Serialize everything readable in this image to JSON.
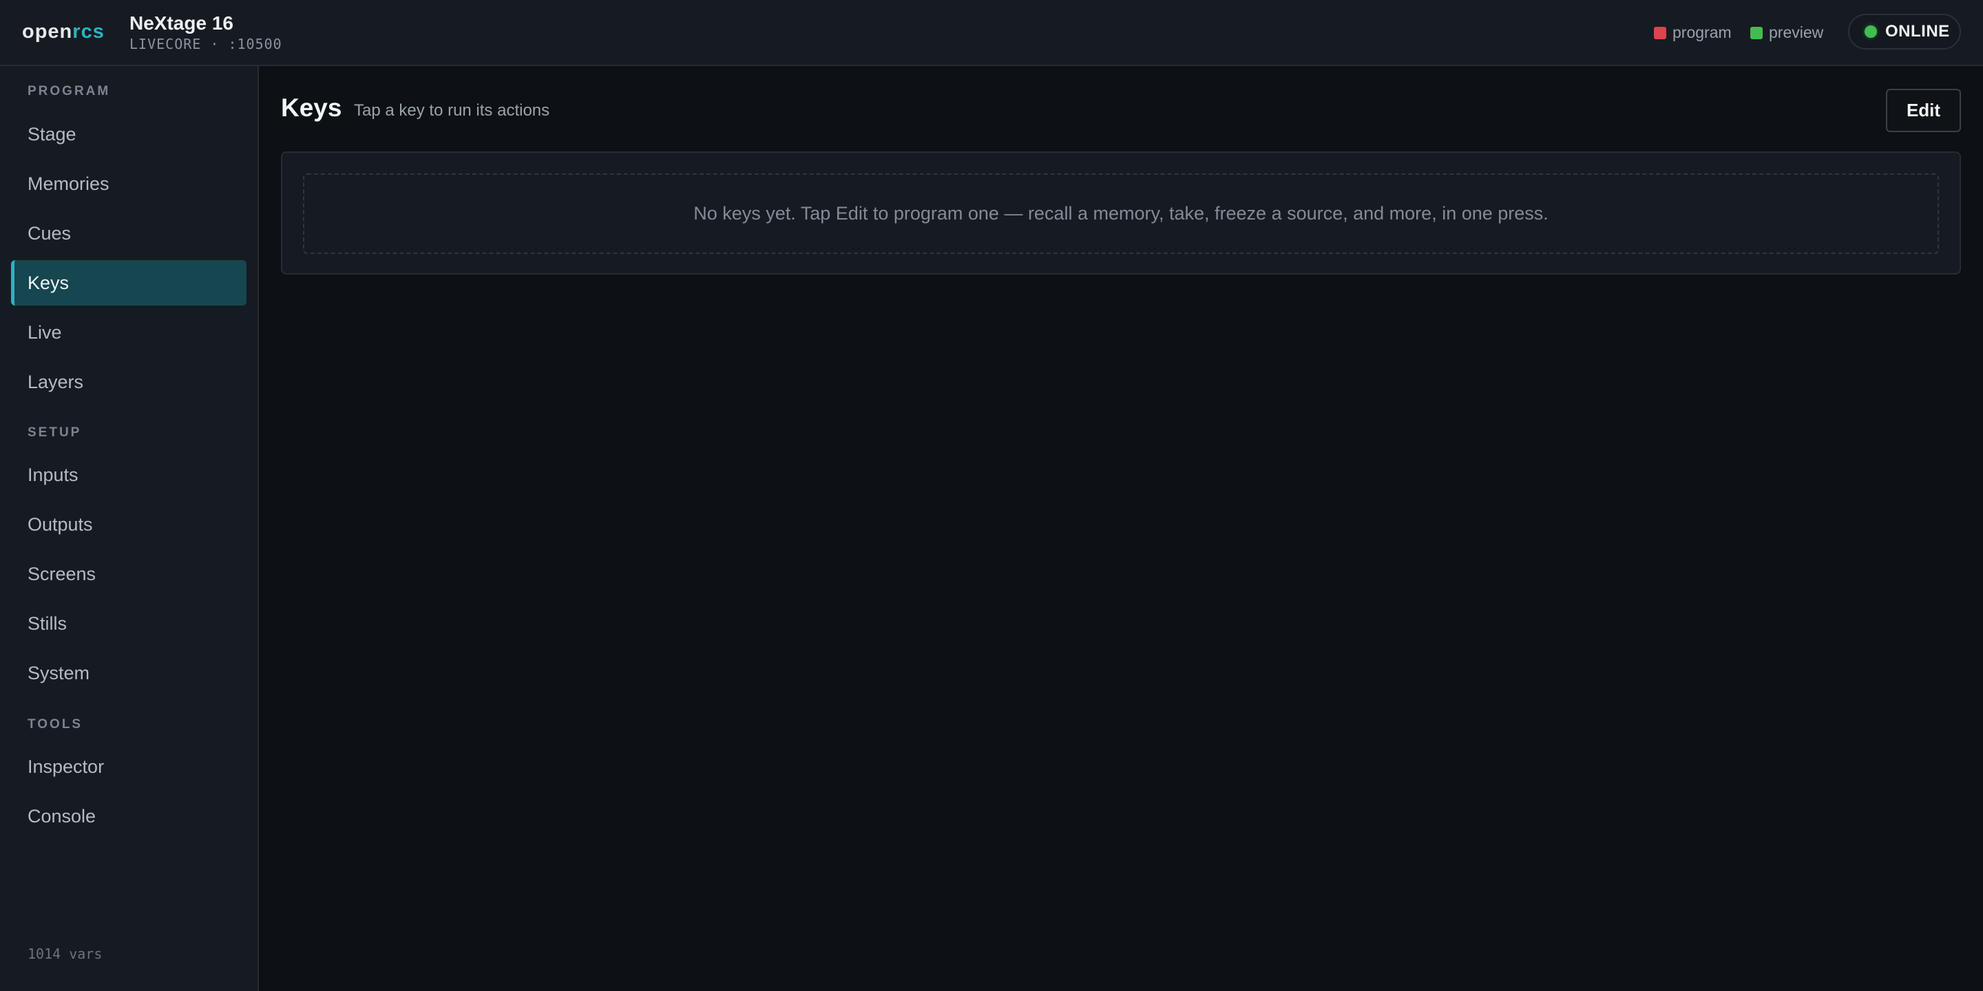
{
  "header": {
    "logo_part1": "open",
    "logo_part2": "rcs",
    "device_name": "NeXtage 16",
    "device_sub": "LIVECORE · :10500",
    "legend": [
      {
        "label": "program",
        "color": "#e0424f"
      },
      {
        "label": "preview",
        "color": "#3fbf4f"
      }
    ],
    "status": "ONLINE",
    "status_color": "#3fbf4f"
  },
  "sidebar": {
    "sections": [
      {
        "label": "PROGRAM",
        "items": [
          "Stage",
          "Memories",
          "Cues",
          "Keys",
          "Live",
          "Layers"
        ]
      },
      {
        "label": "SETUP",
        "items": [
          "Inputs",
          "Outputs",
          "Screens",
          "Stills",
          "System"
        ]
      },
      {
        "label": "TOOLS",
        "items": [
          "Inspector",
          "Console"
        ]
      }
    ],
    "active_item": "Keys",
    "footer": "1014 vars"
  },
  "main": {
    "title": "Keys",
    "subtitle": "Tap a key to run its actions",
    "edit_label": "Edit",
    "empty_message": "No keys yet. Tap Edit to program one — recall a memory, take, freeze a source, and more, in one press."
  },
  "colors": {
    "accent": "#2bb3c0",
    "active_bg": "#164650"
  }
}
